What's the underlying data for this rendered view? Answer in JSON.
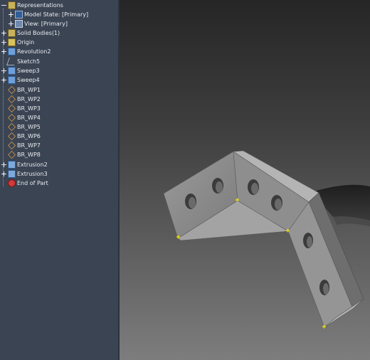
{
  "browser": {
    "representations": "Representations",
    "model_state": "Model State: [Primary]",
    "view": "View: [Primary]",
    "solid_bodies": "Solid Bodies(1)",
    "origin": "Origin",
    "revolution2": "Revolution2",
    "sketch5": "Sketch5",
    "sweep3": "Sweep3",
    "sweep4": "Sweep4",
    "work_points": [
      "BR_WP1",
      "BR_WP2",
      "BR_WP3",
      "BR_WP4",
      "BR_WP5",
      "BR_WP6",
      "BR_WP7",
      "BR_WP8"
    ],
    "extrusion2": "Extrusion2",
    "extrusion3": "Extrusion3",
    "end_of_part": "End of Part"
  },
  "icons": {
    "representations": "representations-icon",
    "model_state": "model-state-icon",
    "view": "view-icon",
    "solid_bodies": "solid-bodies-icon",
    "origin": "origin-folder-icon",
    "feature": "feature-icon",
    "sketch": "sketch-icon",
    "work_point": "work-point-icon",
    "end_of_part": "end-of-part-icon"
  },
  "colors": {
    "browser_bg": "#3b4453",
    "text": "#e8ecf1",
    "work_point": "#e0a24a",
    "end_of_part": "#d23a3a",
    "part_face": "#8c8c8c",
    "part_face_light": "#a5a5a5",
    "snap_marker": "#e8e000"
  }
}
